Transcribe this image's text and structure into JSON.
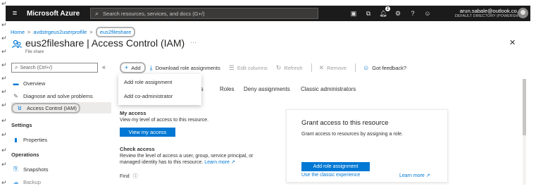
{
  "topbar": {
    "brand": "Microsoft Azure",
    "search_placeholder": "Search resources, services, and docs (G+/)",
    "notifications_count": "1",
    "account_email": "arun.sabale@outlook.co...",
    "account_directory": "DEFAULT DIRECTORY (POWERSH..."
  },
  "breadcrumb": {
    "items": [
      "Home",
      "avdstrgeus2userprofile",
      "eus2fileshare"
    ]
  },
  "page": {
    "title": "eus2fileshare | Access Control (IAM)",
    "subtitle": "File share"
  },
  "sidebar": {
    "search_placeholder": "Search (Ctrl+/)",
    "items": [
      {
        "label": "Overview"
      },
      {
        "label": "Diagnose and solve problems"
      },
      {
        "label": "Access Control (IAM)"
      }
    ],
    "groups": [
      "Settings",
      "Operations"
    ],
    "settings_items": [
      {
        "label": "Properties"
      }
    ],
    "operations_items": [
      {
        "label": "Snapshots"
      },
      {
        "label": "Backup"
      }
    ]
  },
  "commandbar": {
    "add": "Add",
    "download": "Download role assignments",
    "edit_columns": "Edit columns",
    "refresh": "Refresh",
    "remove": "Remove",
    "feedback": "Got feedback?"
  },
  "dropdown": {
    "items": [
      "Add role assignment",
      "Add co-administrator"
    ]
  },
  "tabs": [
    "nts",
    "Roles",
    "Deny assignments",
    "Classic administrators"
  ],
  "my_access": {
    "heading": "My access",
    "text": "View my level of access to this resource.",
    "button": "View my access"
  },
  "check_access": {
    "heading": "Check access",
    "text_line1": "Review the level of access a user, group, service principal, or",
    "text_line2": "managed identity has to this resource.",
    "learn_more": "Learn more",
    "find_label": "Find"
  },
  "grant_card": {
    "title": "Grant access to this resource",
    "description": "Grant access to resources by assigning a role.",
    "button": "Add role assignment",
    "classic_link": "Use the classic experience",
    "learn_more": "Learn more"
  },
  "paragraph_mark": "↵"
}
